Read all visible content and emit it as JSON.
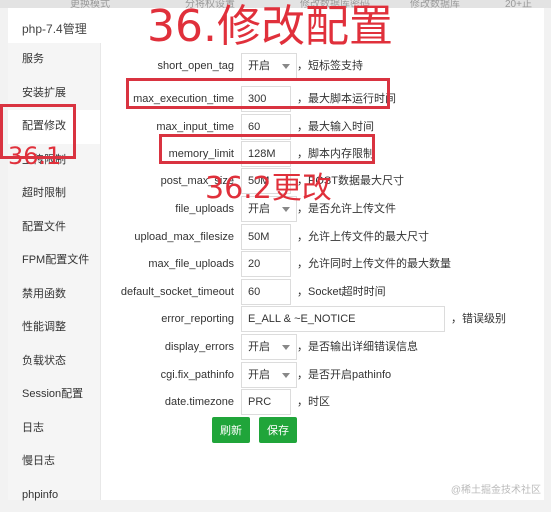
{
  "panel": {
    "title": "php-7.4管理"
  },
  "sidebar": {
    "items": [
      {
        "label": "服务"
      },
      {
        "label": "安装扩展"
      },
      {
        "label": "配置修改",
        "active": true
      },
      {
        "label": "上传限制"
      },
      {
        "label": "超时限制"
      },
      {
        "label": "配置文件"
      },
      {
        "label": "FPM配置文件"
      },
      {
        "label": "禁用函数"
      },
      {
        "label": "性能调整"
      },
      {
        "label": "负载状态"
      },
      {
        "label": "Session配置"
      },
      {
        "label": "日志"
      },
      {
        "label": "慢日志"
      },
      {
        "label": "phpinfo"
      }
    ]
  },
  "config": {
    "rows": [
      {
        "label": "short_open_tag",
        "kind": "select",
        "value": "开启",
        "desc": "，短标签支持"
      },
      {
        "label": "max_execution_time",
        "kind": "input",
        "value": "300",
        "desc": "，最大脚本运行时间"
      },
      {
        "label": "max_input_time",
        "kind": "input",
        "value": "60",
        "desc": "，最大输入时间"
      },
      {
        "label": "memory_limit",
        "kind": "input",
        "value": "128M",
        "desc": "，脚本内存限制"
      },
      {
        "label": "post_max_size",
        "kind": "input",
        "value": "50M",
        "desc": "，POST数据最大尺寸"
      },
      {
        "label": "file_uploads",
        "kind": "select",
        "value": "开启",
        "desc": "，是否允许上传文件"
      },
      {
        "label": "upload_max_filesize",
        "kind": "input",
        "value": "50M",
        "desc": "，允许上传文件的最大尺寸"
      },
      {
        "label": "max_file_uploads",
        "kind": "input",
        "value": "20",
        "desc": "，允许同时上传文件的最大数量"
      },
      {
        "label": "default_socket_timeout",
        "kind": "input",
        "value": "60",
        "desc": "，Socket超时时间"
      },
      {
        "label": "error_reporting",
        "kind": "input-wide",
        "value": "E_ALL & ~E_NOTICE",
        "desc": "，错误级别"
      },
      {
        "label": "display_errors",
        "kind": "select",
        "value": "开启",
        "desc": "，是否输出详细错误信息"
      },
      {
        "label": "cgi.fix_pathinfo",
        "kind": "select",
        "value": "开启",
        "desc": "，是否开启pathinfo"
      },
      {
        "label": "date.timezone",
        "kind": "input",
        "value": "PRC",
        "desc": "，时区"
      }
    ]
  },
  "buttons": {
    "refresh": "刷新",
    "save": "保存"
  },
  "annotations": {
    "title": "36.修改配置",
    "step1": "36.1",
    "step2": "36.2更改"
  },
  "background_strip": [
    "更换模式",
    "分将权设置",
    "修改数据库密码",
    "修改数据库",
    "20+正"
  ],
  "watermark": "@稀土掘金技术社区",
  "colors": {
    "accent": "#20a53a",
    "annotation": "#d93340"
  }
}
